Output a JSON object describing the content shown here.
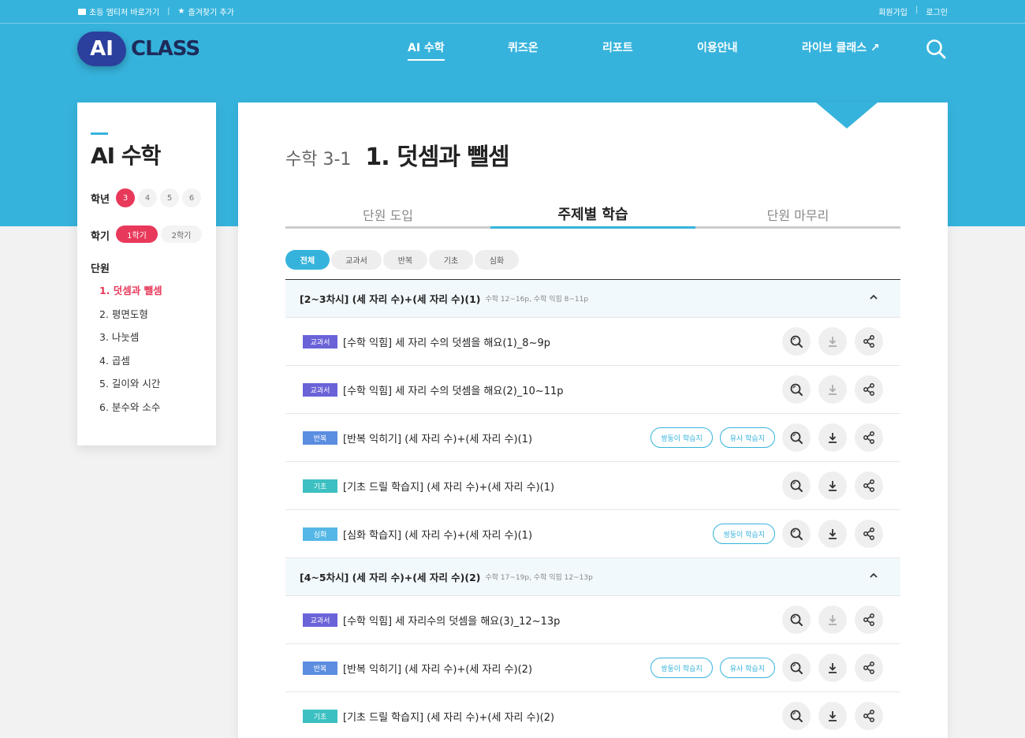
{
  "topbar": {
    "left": [
      "초등 엠티처 바로가기",
      "즐겨찾기 추가"
    ],
    "right": [
      "회원가입",
      "로그인"
    ]
  },
  "logo": {
    "ai": "AI",
    "class": "CLASS"
  },
  "nav": [
    "AI 수학",
    "퀴즈온",
    "리포트",
    "이용안내",
    "라이브 클래스 ↗"
  ],
  "sidebar": {
    "title": "AI 수학",
    "grade_label": "학년",
    "grades": [
      "3",
      "4",
      "5",
      "6"
    ],
    "semester_label": "학기",
    "semesters": [
      "1학기",
      "2학기"
    ],
    "unit_label": "단원",
    "units": [
      "1. 덧셈과 뺄셈",
      "2. 평면도형",
      "3. 나눗셈",
      "4. 곱셈",
      "5. 길이와 시간",
      "6. 분수와 소수"
    ]
  },
  "page": {
    "subject": "수학 3-1",
    "title": "1. 덧셈과 뺄셈",
    "tabs": [
      "단원 도입",
      "주제별 학습",
      "단원 마무리"
    ],
    "filters": [
      "전체",
      "교과서",
      "반복",
      "기초",
      "심화"
    ]
  },
  "sections": [
    {
      "title": "[2~3차시] (세 자리 수)+(세 자리 수)(1)",
      "sub": "수학 12~16p, 수학 익힘 8~11p",
      "rows": [
        {
          "badge": "교과서",
          "text": "[수학 익힘] 세 자리 수의 덧셈을 해요(1)_8~9p",
          "pills": []
        },
        {
          "badge": "교과서",
          "text": "[수학 익힘] 세 자리 수의 덧셈을 해요(2)_10~11p",
          "pills": []
        },
        {
          "badge": "반복",
          "text": "[반복 익히기] (세 자리 수)+(세 자리 수)(1)",
          "pills": [
            "쌍둥이 학습지",
            "유사 학습지"
          ]
        },
        {
          "badge": "기초",
          "text": "[기초 드릴 학습지] (세 자리 수)+(세 자리 수)(1)",
          "pills": []
        },
        {
          "badge": "심화",
          "text": "[심화 학습지] (세 자리 수)+(세 자리 수)(1)",
          "pills": [
            "쌍둥이 학습지"
          ]
        }
      ]
    },
    {
      "title": "[4~5차시] (세 자리 수)+(세 자리 수)(2)",
      "sub": "수학 17~19p, 수학 익힘 12~13p",
      "rows": [
        {
          "badge": "교과서",
          "text": "[수학 익힘] 세 자리수의 덧셈을 해요(3)_12~13p",
          "pills": []
        },
        {
          "badge": "반복",
          "text": "[반복 익히기] (세 자리 수)+(세 자리 수)(2)",
          "pills": [
            "쌍둥이 학습지",
            "유사 학습지"
          ]
        },
        {
          "badge": "기초",
          "text": "[기초 드릴 학습지] (세 자리 수)+(세 자리 수)(2)",
          "pills": []
        }
      ]
    }
  ]
}
